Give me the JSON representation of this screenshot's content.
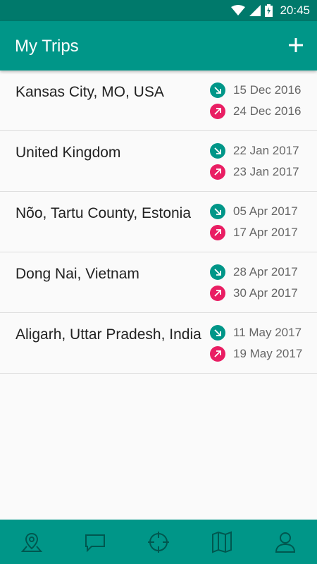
{
  "status_bar": {
    "time": "20:45"
  },
  "app_bar": {
    "title": "My Trips",
    "add_icon": "plus-icon"
  },
  "trips": [
    {
      "name": "Kansas City, MO, USA",
      "arrive": "15 Dec 2016",
      "depart": "24 Dec 2016"
    },
    {
      "name": "United Kingdom",
      "arrive": "22 Jan 2017",
      "depart": "23 Jan 2017"
    },
    {
      "name": "Nõo, Tartu County, Estonia",
      "arrive": "05 Apr 2017",
      "depart": "17 Apr 2017"
    },
    {
      "name": "Dong Nai, Vietnam",
      "arrive": "28 Apr 2017",
      "depart": "30 Apr 2017"
    },
    {
      "name": "Aligarh, Uttar Pradesh, India",
      "arrive": "11 May 2017",
      "depart": "19 May 2017"
    }
  ],
  "bottom_nav": [
    {
      "icon": "map-pin-icon"
    },
    {
      "icon": "chat-icon"
    },
    {
      "icon": "crosshair-icon"
    },
    {
      "icon": "map-icon"
    },
    {
      "icon": "person-icon"
    }
  ],
  "colors": {
    "primary_dark": "#00796b",
    "primary": "#009688",
    "accent": "#e91e63"
  }
}
